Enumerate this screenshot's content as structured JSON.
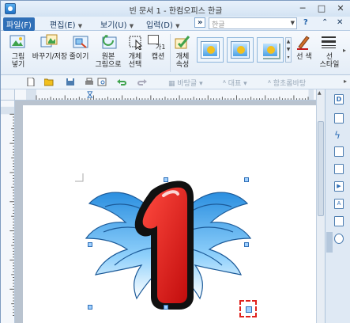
{
  "window": {
    "title": "빈 문서 1 - 한컴오피스 한글",
    "controls": {
      "minimize": "─",
      "maximize": "□",
      "close": "✕"
    }
  },
  "menubar": {
    "file": "파일(F)",
    "edit": "편집(E)",
    "view": "보기(U)",
    "input": "입력(D)",
    "more": "»",
    "font_placeholder": "한글",
    "help": "?",
    "restore": "⌃",
    "close": "✕"
  },
  "ribbon": {
    "picture_save": "그림\n넣기",
    "swap_save": "바꾸기/저장",
    "crop": "줄이기",
    "original_picture": "원본\n그림으로",
    "object_select": "개체\n선택",
    "caption": "캡션",
    "object_props": "개체\n속성",
    "color": "선 색",
    "line_style": "선\n스타일",
    "caption_tag": "가1"
  },
  "toolbar": {
    "style_label": "바탕글",
    "rep_label": "대표",
    "font_label": "함초롬바탕"
  },
  "colors": {
    "accent": "#2f6fb7",
    "wing_blue": "#3da7ec",
    "numeral_red": "#e01818",
    "selection_red": "#e0201b"
  },
  "document": {
    "image_description": "winged number one badge",
    "image_numeral": "1"
  }
}
